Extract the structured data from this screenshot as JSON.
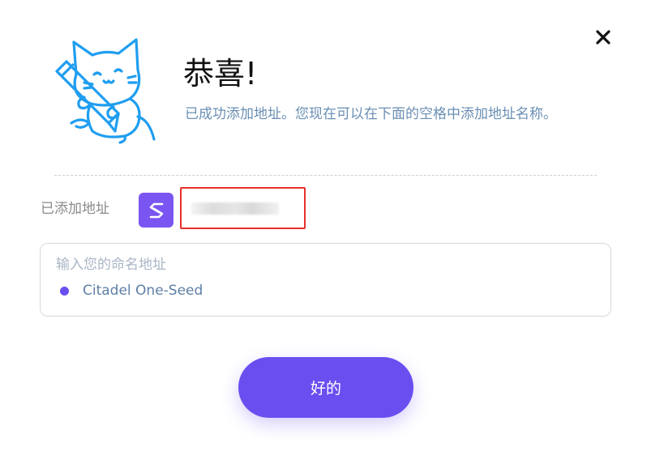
{
  "dialog": {
    "title": "恭喜!",
    "subtitle": "已成功添加地址。您现在可以在下面的空格中添加地址名称。",
    "close_icon": "close-icon",
    "mascot_icon": "cat-with-pencil-icon"
  },
  "added_address": {
    "label": "已添加地址",
    "token_icon": "citadel-logo-icon",
    "address_value": ""
  },
  "name_field": {
    "placeholder": "输入您的命名地址",
    "value": "",
    "suggestion": "Citadel One-Seed"
  },
  "ok_button": {
    "label": "好的"
  },
  "colors": {
    "accent": "#6b4ef0",
    "mascot": "#1f9ef0",
    "highlight_border": "#e8302b",
    "subtitle_text": "#6a8fb3"
  }
}
